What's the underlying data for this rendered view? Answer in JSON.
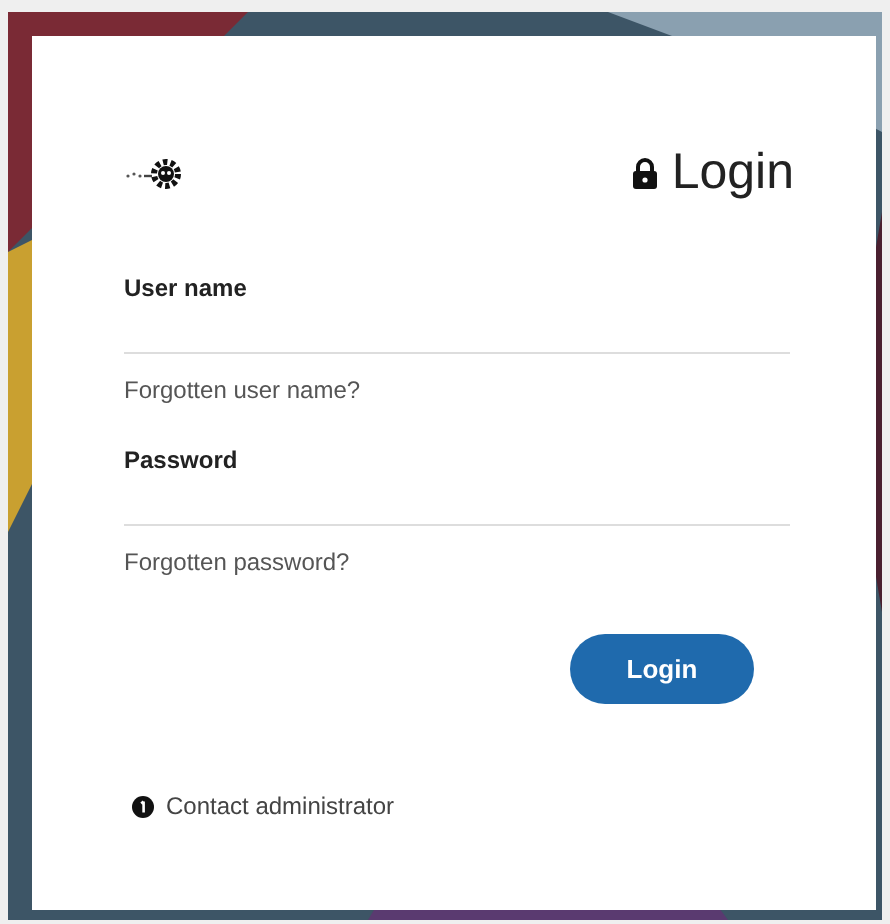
{
  "title": "Login",
  "fields": [
    {
      "label": "User name",
      "link": "Forgotten user name?"
    },
    {
      "label": "Password",
      "link": "Forgotten password?"
    }
  ],
  "button": "Login",
  "contact": "Contact administrator"
}
